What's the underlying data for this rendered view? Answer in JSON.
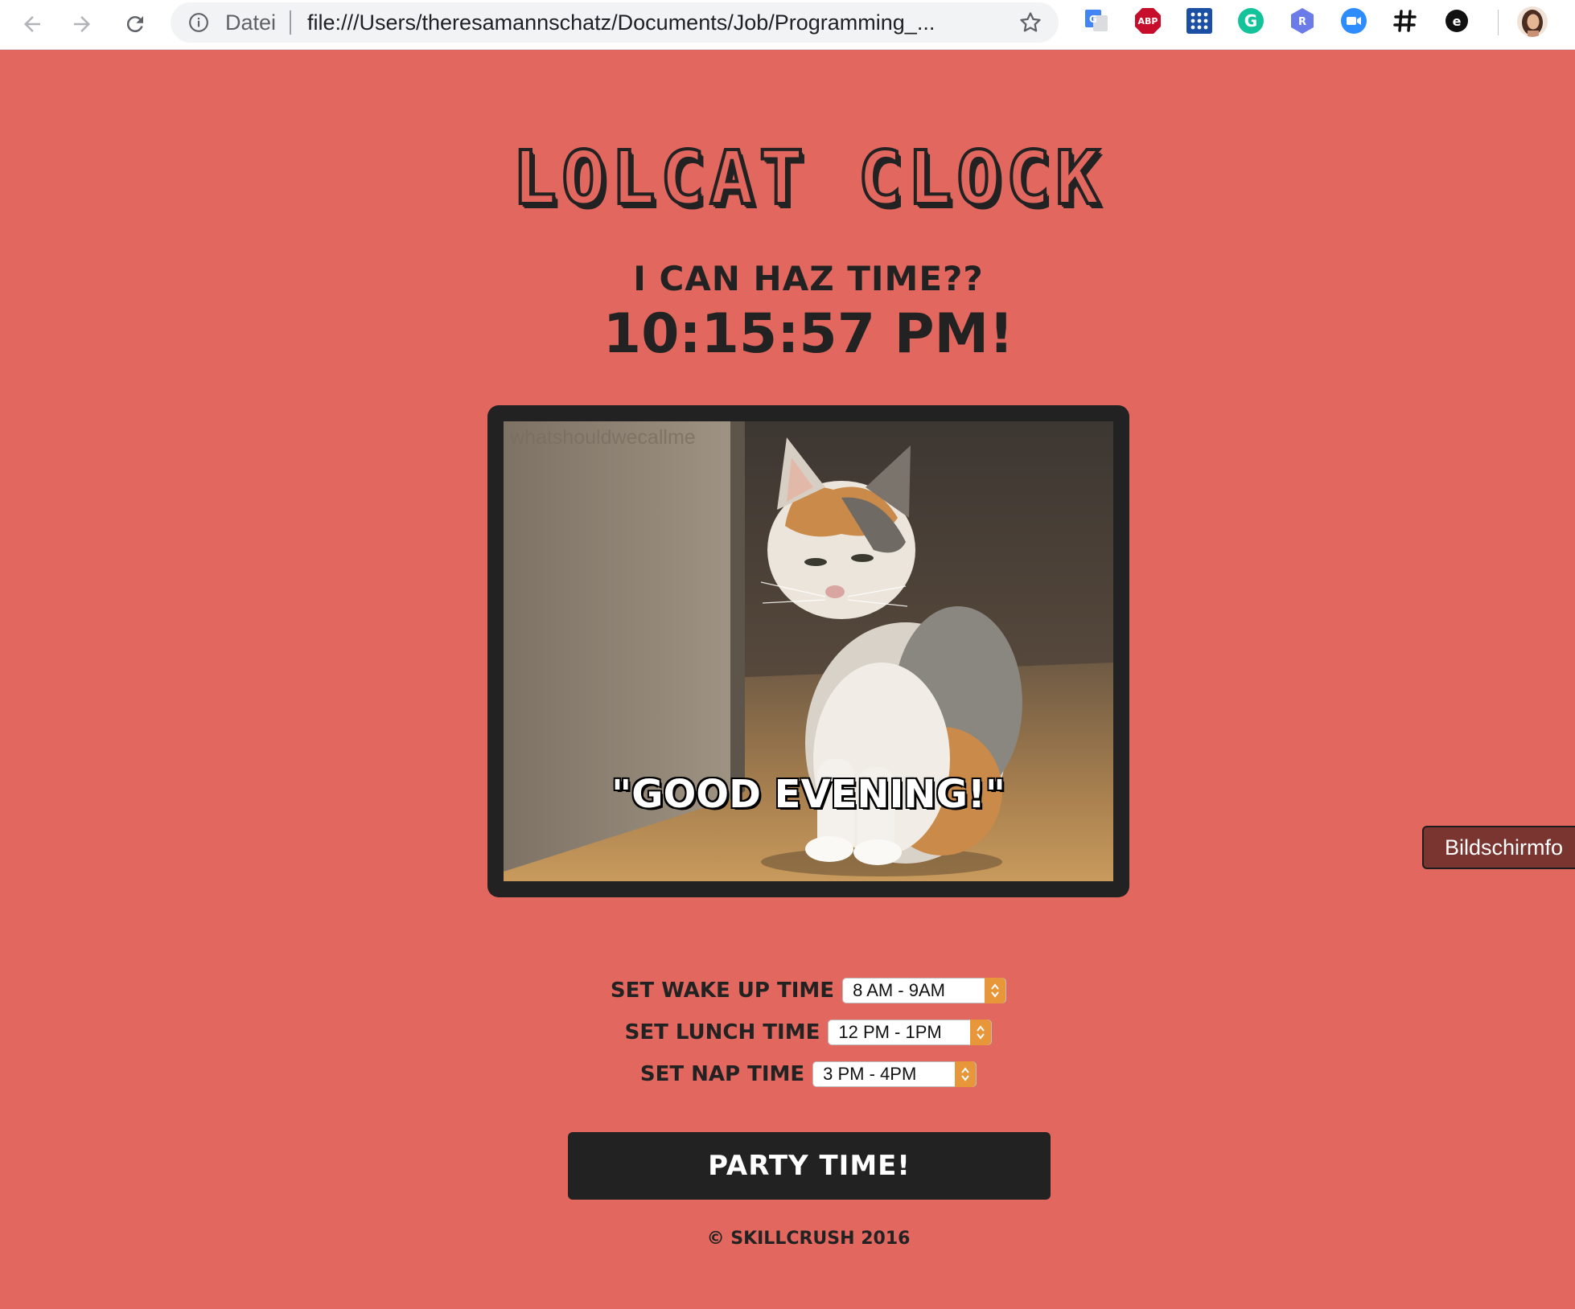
{
  "browser": {
    "omnibox_label": "Datei",
    "url": "file:///Users/theresamannschatz/Documents/Job/Programming_...",
    "extensions": [
      "google-translate-icon",
      "adblock-plus-icon",
      "dots-grid-icon",
      "grammarly-icon",
      "r-shield-icon",
      "zoom-icon",
      "hashtag-icon",
      "e-circle-icon"
    ],
    "abp_badge_text": "ABP"
  },
  "page": {
    "title": "LOLCAT CLOCK",
    "subtitle": "I CAN HAZ TIME??",
    "clock_time": "10:15:57 PM!",
    "image_watermark": "whatshouldwecallme",
    "image_caption": "\"GOOD EVENING!\"",
    "settings": [
      {
        "label": "SET WAKE UP TIME",
        "value": "8 AM - 9AM"
      },
      {
        "label": "SET LUNCH TIME",
        "value": "12 PM - 1PM"
      },
      {
        "label": "SET NAP TIME",
        "value": "3 PM - 4PM"
      }
    ],
    "party_button": "PARTY TIME!",
    "footer": "© SKILLCRUSH 2016",
    "side_tab": "Bildschirmfo"
  },
  "colors": {
    "background": "#e2685f",
    "dark": "#222222",
    "select_caret": "#e8963a",
    "side_tab": "#7a3530"
  }
}
